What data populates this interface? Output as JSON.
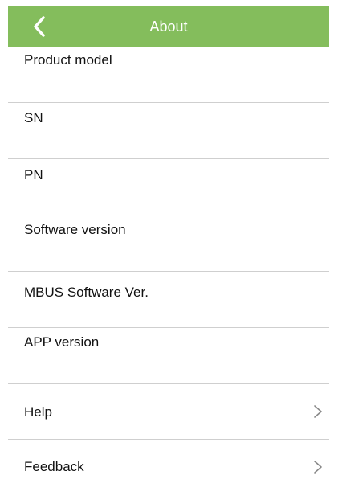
{
  "header": {
    "title": "About",
    "back_icon": "chevron-left-icon",
    "bg_color": "#84bd5c"
  },
  "rows": [
    {
      "label": "Product model",
      "value": ""
    },
    {
      "label": "SN",
      "value": ""
    },
    {
      "label": "PN",
      "value": ""
    },
    {
      "label": "Software version",
      "value": ""
    },
    {
      "label": "MBUS Software Ver.",
      "value": ""
    },
    {
      "label": "APP version",
      "value": ""
    },
    {
      "label": "Help",
      "chevron_icon": "chevron-right-icon"
    },
    {
      "label": "Feedback",
      "chevron_icon": "chevron-right-icon"
    }
  ]
}
